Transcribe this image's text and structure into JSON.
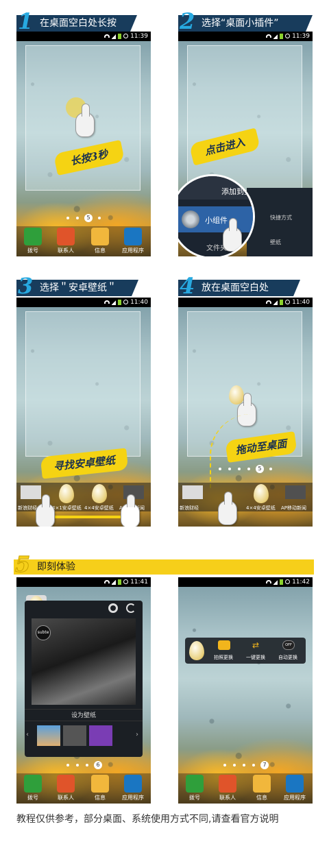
{
  "steps": {
    "s1": {
      "num": "1",
      "title": "在桌面空白处长按",
      "note": "长按3秒"
    },
    "s2": {
      "num": "2",
      "title": "选择“桌面小插件”",
      "note": "点击进入"
    },
    "s3": {
      "num": "3",
      "title": "选择＂安卓壁纸＂",
      "note": "寻找安卓壁纸"
    },
    "s4": {
      "num": "4",
      "title": "放在桌面空白处",
      "note": "拖动至桌面"
    },
    "s5": {
      "num": "5",
      "title": "即刻体验"
    }
  },
  "status_times": {
    "p1": "11:39",
    "p2": "11:39",
    "p3": "11:40",
    "p4": "11:40",
    "p5": "11:41",
    "p6": "11:42"
  },
  "dock": [
    "拨号",
    "联系人",
    "信息",
    "应用程序"
  ],
  "dock_colors": [
    "#2f9f3b",
    "#e0542a",
    "#f1b73c",
    "#1a76c2"
  ],
  "page_indicators": {
    "p1": "5",
    "p4": "5",
    "p5": "6",
    "p6": "7"
  },
  "add_menu": {
    "title": "添加到主",
    "widgets": "小组件",
    "shortcut": "快捷方式",
    "wallpaper": "壁纸",
    "folder": "文件夹"
  },
  "widget_tray": {
    "left": "新浪财经",
    "w1": "4×1安卓壁纸",
    "w2": "4×4安卓壁纸",
    "right": "AP移动新闻"
  },
  "widget_tray_p4": {
    "left": "新浪财经",
    "w2": "4×4安卓壁纸",
    "right": "AP移动新闻"
  },
  "set_wallpaper": "设为壁纸",
  "badge": "subte",
  "widget_bar": {
    "photo": "拍照更换",
    "one_key": "一键更换",
    "auto": "自动更换",
    "off": "OFF"
  },
  "footer": "教程仅供参考，部分桌面、系统使用方式不同,请查看官方说明"
}
